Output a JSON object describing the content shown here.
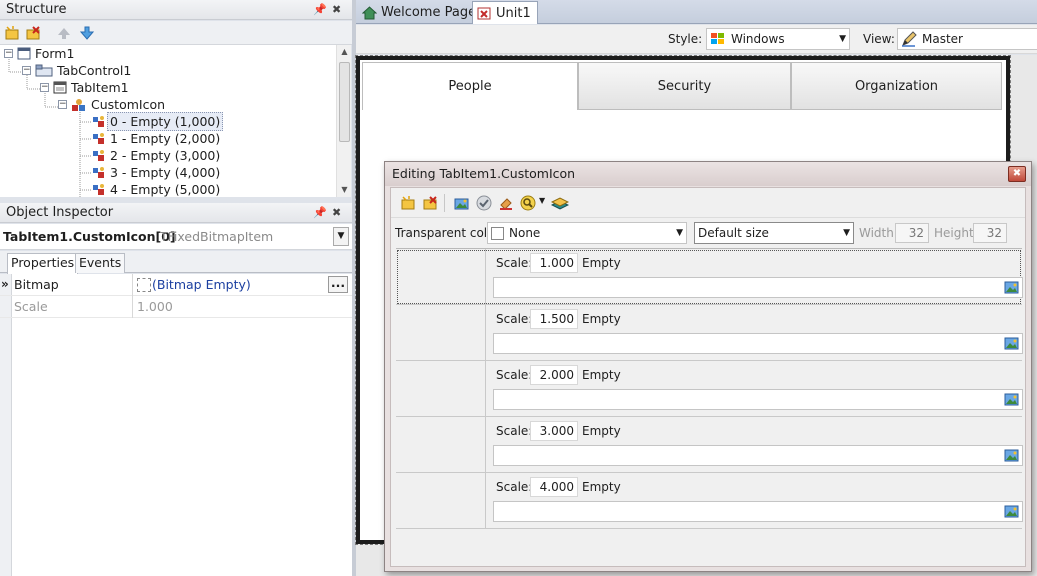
{
  "structure": {
    "title": "Structure",
    "tree": [
      {
        "label": "Form1",
        "icon": "form-icon"
      },
      {
        "label": "TabControl1",
        "icon": "tabcontrol-icon"
      },
      {
        "label": "TabItem1",
        "icon": "tabitem-icon"
      },
      {
        "label": "CustomIcon",
        "icon": "collection-icon"
      },
      {
        "label": "0 - Empty (1,000)",
        "icon": "bitmap-item-icon"
      },
      {
        "label": "1 - Empty (2,000)",
        "icon": "bitmap-item-icon"
      },
      {
        "label": "2 - Empty (3,000)",
        "icon": "bitmap-item-icon"
      },
      {
        "label": "3 - Empty (4,000)",
        "icon": "bitmap-item-icon"
      },
      {
        "label": "4 - Empty (5,000)",
        "icon": "bitmap-item-icon"
      }
    ]
  },
  "inspector": {
    "title": "Object Inspector",
    "object_name": "TabItem1.CustomIcon[0]",
    "object_type": "TFixedBitmapItem",
    "tabs": [
      "Properties",
      "Events"
    ],
    "properties": [
      {
        "name": "Bitmap",
        "value": "(Bitmap Empty)",
        "button": "..."
      },
      {
        "name": "Scale",
        "value": "1.000"
      }
    ]
  },
  "doc_tabs": [
    "Welcome Page",
    "Unit1"
  ],
  "style_bar": {
    "style_label": "Style:",
    "style_value": "Windows",
    "view_label": "View:",
    "view_value": "Master"
  },
  "form_tabs": [
    "People",
    "Security",
    "Organization"
  ],
  "dialog": {
    "title": "Editing TabItem1.CustomIcon",
    "transparent_label": "Transparent color:",
    "transparent_value": "None",
    "size_value": "Default size",
    "width_label": "Width:",
    "width_value": "32",
    "height_label": "Height:",
    "height_value": "32",
    "rows": [
      {
        "scale_label": "Scale:",
        "scale": "1.000",
        "status": "Empty"
      },
      {
        "scale_label": "Scale:",
        "scale": "1.500",
        "status": "Empty"
      },
      {
        "scale_label": "Scale:",
        "scale": "2.000",
        "status": "Empty"
      },
      {
        "scale_label": "Scale:",
        "scale": "3.000",
        "status": "Empty"
      },
      {
        "scale_label": "Scale:",
        "scale": "4.000",
        "status": "Empty"
      }
    ]
  },
  "colors": {
    "accent": "#3e6bbf",
    "dialog_title": "#d9cece",
    "close_red": "#c0493a"
  }
}
